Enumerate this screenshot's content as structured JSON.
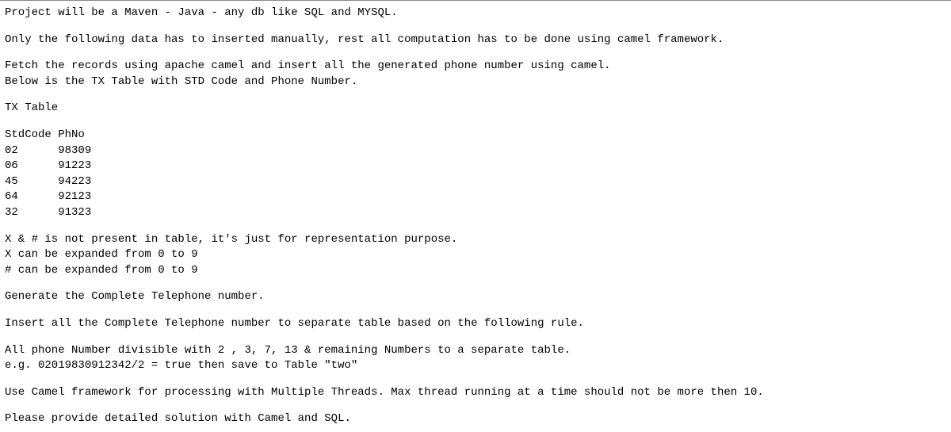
{
  "p1": "Project will be a Maven - Java - any db like SQL and MYSQL.",
  "p2": "Only the following data has to inserted manually, rest all computation has to be done using camel framework.",
  "p3a": "Fetch the records using  apache camel and insert all the generated phone number using camel.",
  "p3b": "Below is the TX Table with STD Code and Phone Number.",
  "tableTitle": "TX Table",
  "tableHeader": "StdCode PhNo",
  "tableRows": [
    {
      "std": "02",
      "ph": "98309"
    },
    {
      "std": "06",
      "ph": "91223"
    },
    {
      "std": "45",
      "ph": "94223"
    },
    {
      "std": "64",
      "ph": "92123"
    },
    {
      "std": "32",
      "ph": "91323"
    }
  ],
  "tableRowsFormatted": [
    "02      98309",
    "06      91223",
    "45      94223",
    "64      92123",
    "32      91323"
  ],
  "note1": "X & # is not present in table, it's just for representation purpose.",
  "note2": "X can be expanded from 0 to 9",
  "note3": "# can be expanded from 0 to 9",
  "p4": "Generate the Complete Telephone number.",
  "p5": "Insert all the Complete Telephone number to separate table based on the following rule.",
  "p6a": "All phone Number divisible with 2 , 3, 7, 13 & remaining Numbers to a separate table.",
  "p6b": "e.g. 02019830912342/2 = true  then save to Table \"two\"",
  "p7": "Use Camel framework for processing with Multiple Threads. Max thread running at a time should not be more then 10.",
  "p8": "Please provide detailed solution with Camel and SQL."
}
